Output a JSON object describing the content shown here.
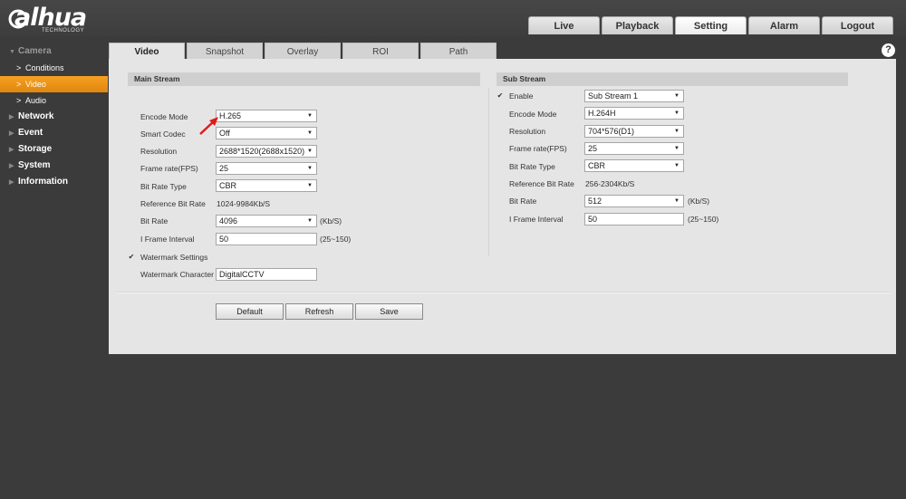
{
  "brand": {
    "logo_text": "alhua",
    "logo_sub": "TECHNOLOGY"
  },
  "topnav": {
    "tabs": [
      "Live",
      "Playback",
      "Setting",
      "Alarm",
      "Logout"
    ],
    "active": "Setting"
  },
  "sidebar": {
    "camera": "Camera",
    "camera_items": [
      "Conditions",
      "Video",
      "Audio"
    ],
    "active_item": "Video",
    "categories": [
      "Network",
      "Event",
      "Storage",
      "System",
      "Information"
    ]
  },
  "content_tabs": {
    "tabs": [
      "Video",
      "Snapshot",
      "Overlay",
      "ROI",
      "Path"
    ],
    "active": "Video"
  },
  "help_icon": "?",
  "main_stream": {
    "title": "Main Stream",
    "encode_mode": {
      "label": "Encode Mode",
      "value": "H.265"
    },
    "smart_codec": {
      "label": "Smart Codec",
      "value": "Off"
    },
    "resolution": {
      "label": "Resolution",
      "value": "2688*1520(2688x1520)"
    },
    "frame_rate": {
      "label": "Frame rate(FPS)",
      "value": "25"
    },
    "bit_rate_type": {
      "label": "Bit Rate Type",
      "value": "CBR"
    },
    "reference_bit_rate": {
      "label": "Reference Bit Rate",
      "value": "1024-9984Kb/S"
    },
    "bit_rate": {
      "label": "Bit Rate",
      "value": "4096",
      "unit": "(Kb/S)"
    },
    "i_frame_interval": {
      "label": "I Frame Interval",
      "value": "50",
      "range": "(25~150)"
    },
    "watermark_settings": {
      "label": "Watermark Settings",
      "checked": true
    },
    "watermark_character": {
      "label": "Watermark Character",
      "value": "DigitalCCTV"
    }
  },
  "sub_stream": {
    "title": "Sub Stream",
    "enable": {
      "label": "Enable",
      "checked": true,
      "value": "Sub Stream 1"
    },
    "encode_mode": {
      "label": "Encode Mode",
      "value": "H.264H"
    },
    "resolution": {
      "label": "Resolution",
      "value": "704*576(D1)"
    },
    "frame_rate": {
      "label": "Frame rate(FPS)",
      "value": "25"
    },
    "bit_rate_type": {
      "label": "Bit Rate Type",
      "value": "CBR"
    },
    "reference_bit_rate": {
      "label": "Reference Bit Rate",
      "value": "256-2304Kb/S"
    },
    "bit_rate": {
      "label": "Bit Rate",
      "value": "512",
      "unit": "(Kb/S)"
    },
    "i_frame_interval": {
      "label": "I Frame Interval",
      "value": "50",
      "range": "(25~150)"
    }
  },
  "buttons": {
    "default": "Default",
    "refresh": "Refresh",
    "save": "Save"
  },
  "colors": {
    "accent": "#f39a1e",
    "header_bg": "#434343",
    "panel_bg": "#e5e5e5",
    "annotation_arrow": "#e01b1b"
  },
  "checkmark": "✔",
  "caret": "▼"
}
